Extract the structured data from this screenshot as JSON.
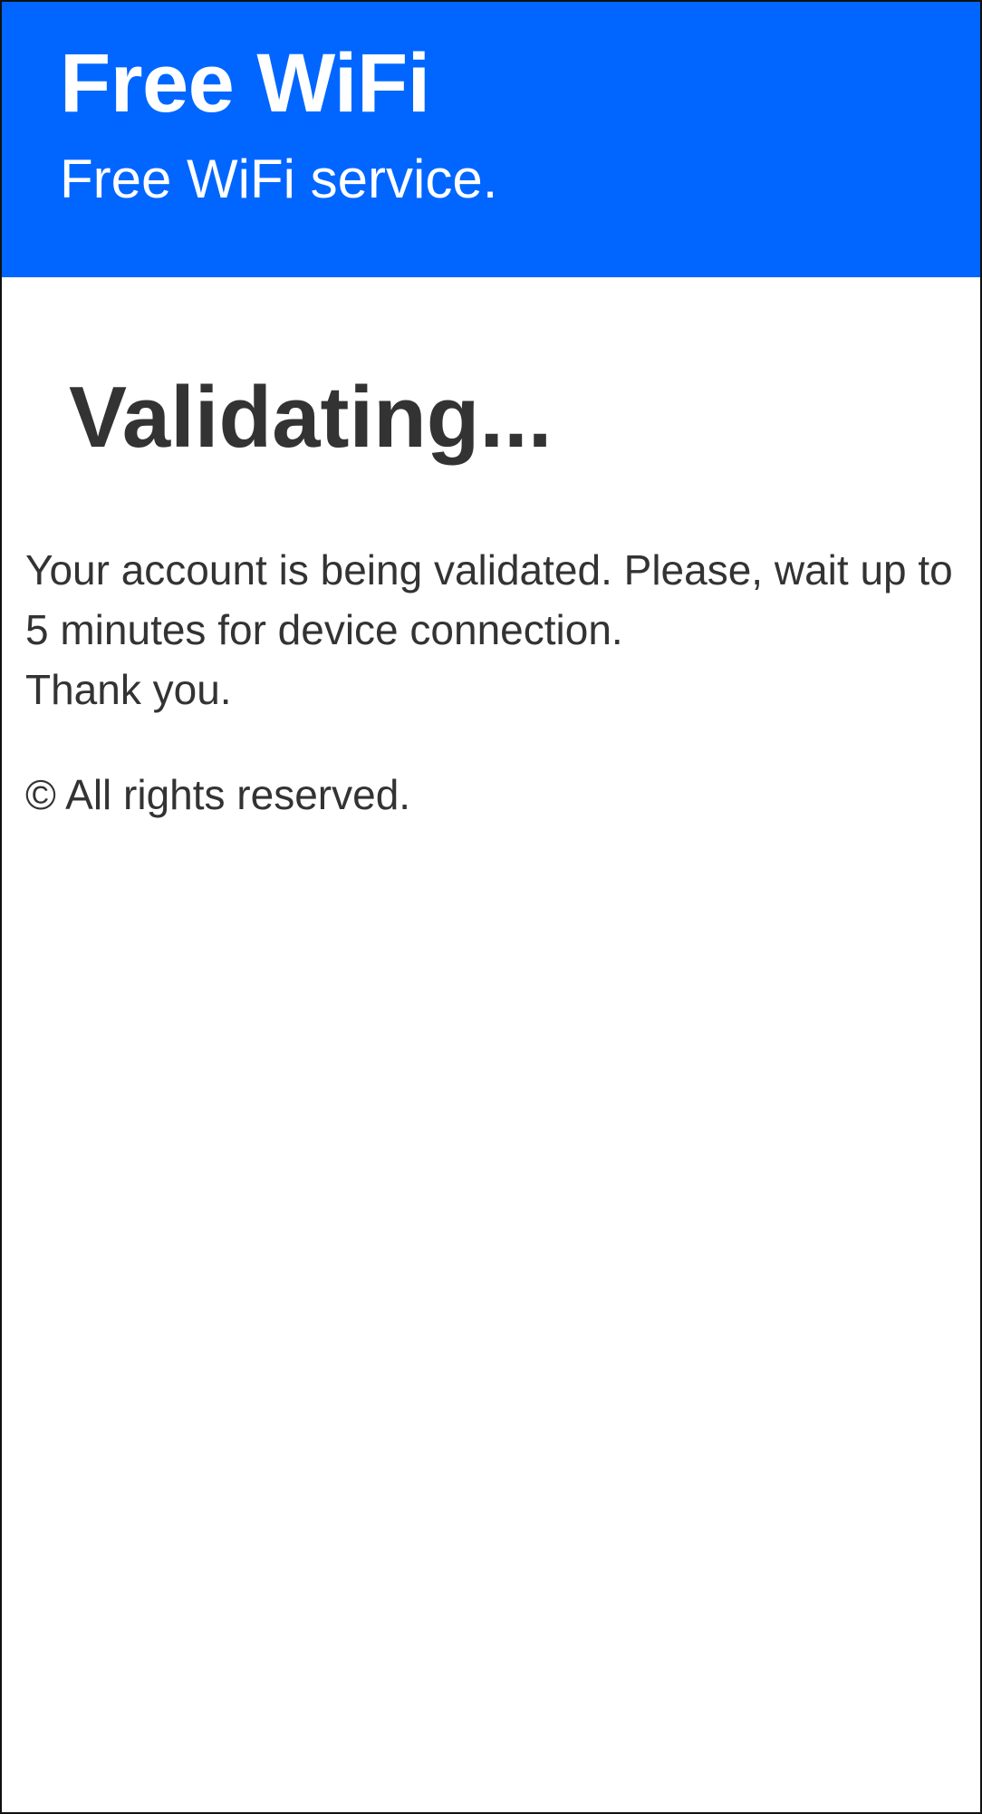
{
  "header": {
    "title": "Free WiFi",
    "subtitle": "Free WiFi service.",
    "background_color": "#0066ff",
    "text_color": "#ffffff"
  },
  "main": {
    "heading": "Validating...",
    "message_line_1": "Your account is being validated. Please, wait up to 5 minutes for device connection.",
    "message_line_2": "Thank you.",
    "text_color": "#333333"
  },
  "footer": {
    "copyright": "© All rights reserved."
  }
}
